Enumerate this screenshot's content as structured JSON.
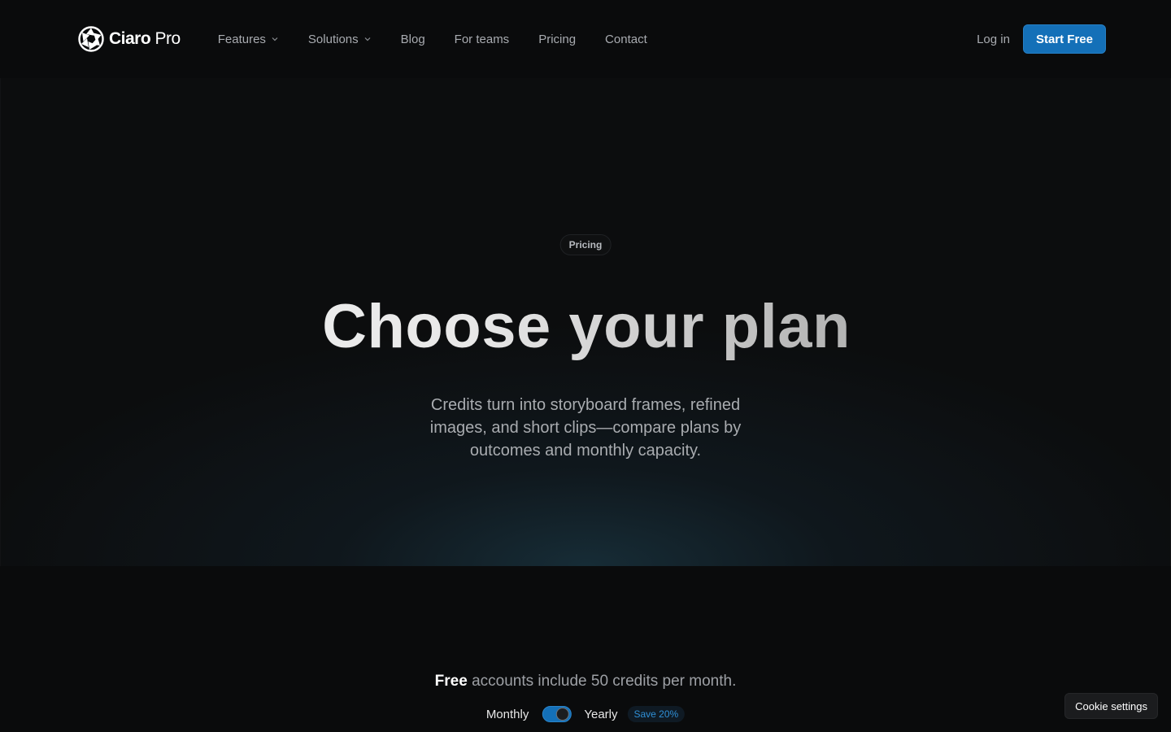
{
  "brand": {
    "name_bold": "Ciaro",
    "name_light": "Pro",
    "logo_icon": "aperture-icon"
  },
  "nav": {
    "items": [
      {
        "label": "Features",
        "has_dropdown": true
      },
      {
        "label": "Solutions",
        "has_dropdown": true
      },
      {
        "label": "Blog",
        "has_dropdown": false
      },
      {
        "label": "For teams",
        "has_dropdown": false
      },
      {
        "label": "Pricing",
        "has_dropdown": false
      },
      {
        "label": "Contact",
        "has_dropdown": false
      }
    ],
    "login_label": "Log in",
    "cta_label": "Start Free"
  },
  "hero": {
    "pill": "Pricing",
    "title": "Choose your plan",
    "subtitle": "Credits turn into storyboard frames, refined images, and short clips—compare plans by outcomes and monthly capacity."
  },
  "pricing": {
    "free_bold": "Free",
    "free_rest": "accounts include 50 credits per month.",
    "monthly_label": "Monthly",
    "yearly_label": "Yearly",
    "billing_selected": "Yearly",
    "save_badge": "Save 20%"
  },
  "cookie_label": "Cookie settings",
  "colors": {
    "accent": "#1470b8",
    "background": "#0a0b0c",
    "badge_text": "#2f8fd6"
  }
}
